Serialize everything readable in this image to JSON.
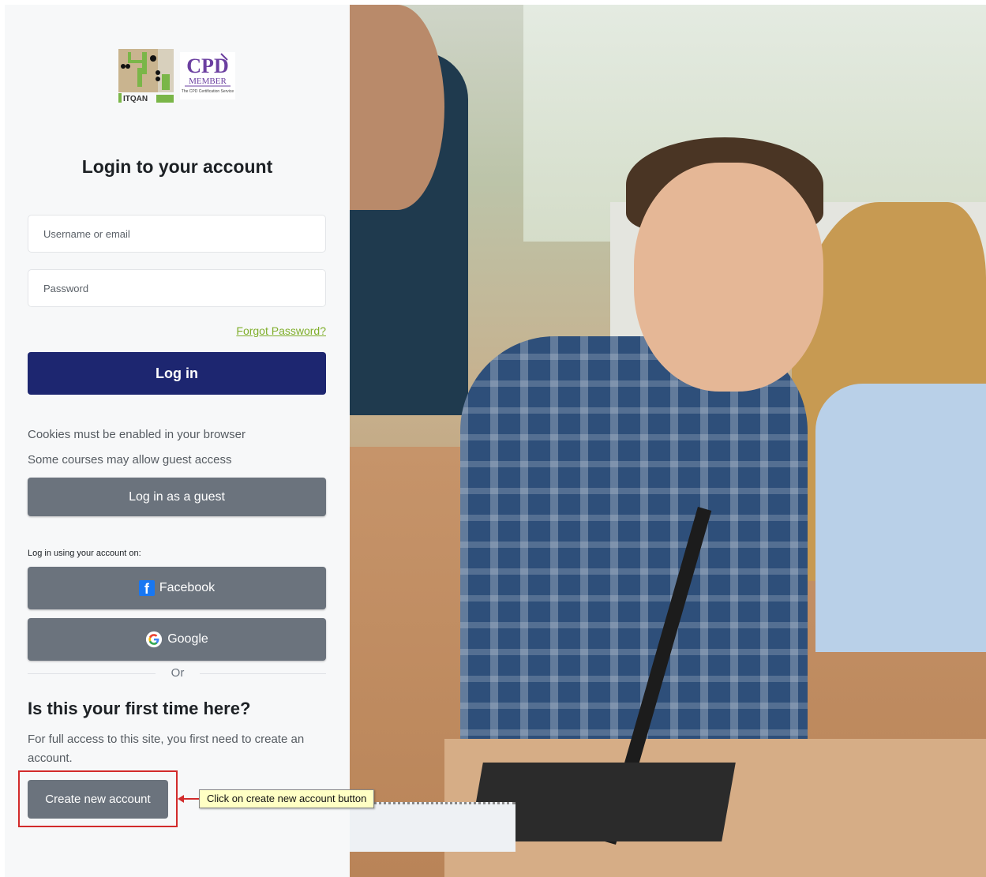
{
  "logos": {
    "itqan_text": "ITQAN",
    "cpd_text": "CPD",
    "cpd_member": "MEMBER",
    "cpd_service": "The CPD Certification Service"
  },
  "login": {
    "title": "Login to your account",
    "username_placeholder": "Username or email",
    "password_placeholder": "Password",
    "forgot_password": "Forgot Password?",
    "login_button": "Log in"
  },
  "notes": {
    "cookies": "Cookies must be enabled in your browser",
    "guest_access": "Some courses may allow guest access",
    "guest_button": "Log in as a guest"
  },
  "social": {
    "label": "Log in using your account on:",
    "facebook": "Facebook",
    "google": "Google",
    "or": "Or"
  },
  "signup": {
    "heading": "Is this your first time here?",
    "description": "For full access to this site, you first need to create an account.",
    "create_button": "Create new account"
  },
  "annotation": {
    "tooltip": "Click on create new account button",
    "highlight_color": "#d22b2b"
  },
  "colors": {
    "primary": "#1d2670",
    "secondary": "#6b737d",
    "link": "#7fae2a"
  },
  "icons": {
    "facebook": "facebook-icon",
    "google": "google-icon"
  }
}
